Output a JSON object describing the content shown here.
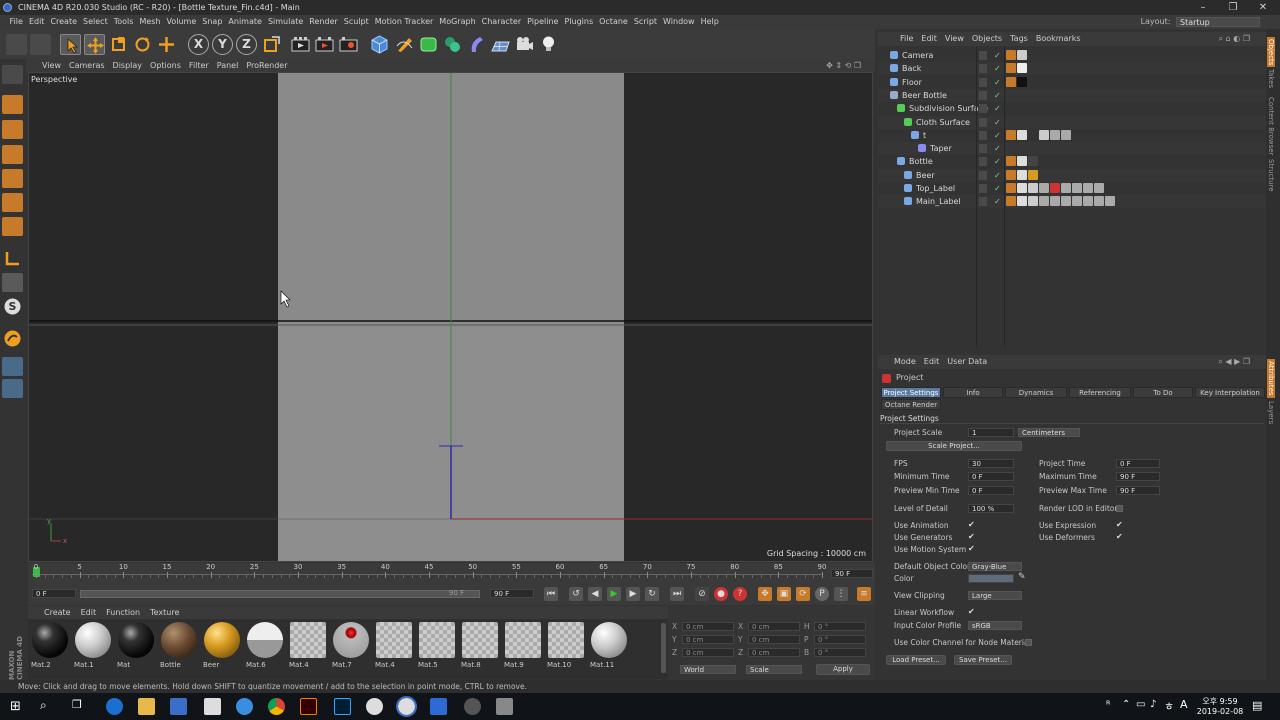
{
  "window": {
    "title": "CINEMA 4D R20.030 Studio (RC - R20) - [Bottle Texture_Fin.c4d] - Main"
  },
  "menu": [
    "File",
    "Edit",
    "Create",
    "Select",
    "Tools",
    "Mesh",
    "Volume",
    "Snap",
    "Animate",
    "Simulate",
    "Render",
    "Sculpt",
    "Motion Tracker",
    "MoGraph",
    "Character",
    "Pipeline",
    "Plugins",
    "Octane",
    "Script",
    "Window",
    "Help"
  ],
  "layout": {
    "label": "Layout:",
    "value": "Startup"
  },
  "toolbar": {
    "x": "X",
    "y": "Y",
    "z": "Z"
  },
  "viewport": {
    "menu": [
      "View",
      "Cameras",
      "Display",
      "Options",
      "Filter",
      "Panel",
      "ProRender"
    ],
    "label": "Perspective",
    "grid_spacing": "Grid Spacing : 10000 cm",
    "axis_x": "x",
    "axis_y": "y"
  },
  "timeline": {
    "ticks": [
      "0",
      "5",
      "10",
      "15",
      "20",
      "25",
      "30",
      "35",
      "40",
      "45",
      "50",
      "55",
      "60",
      "65",
      "70",
      "75",
      "80",
      "85",
      "90"
    ],
    "current_frame": "0 F",
    "start": "0 F",
    "end": "90 F",
    "end_field": "90 F",
    "right_field": "90 F"
  },
  "materials": {
    "menu": [
      "Create",
      "Edit",
      "Function",
      "Texture"
    ],
    "items": [
      {
        "name": "Mat.2",
        "kind": "black"
      },
      {
        "name": "Mat.1",
        "kind": "white"
      },
      {
        "name": "Mat",
        "kind": "black"
      },
      {
        "name": "Bottle",
        "kind": "brown"
      },
      {
        "name": "Beer",
        "kind": "gold"
      },
      {
        "name": "Mat.6",
        "kind": "half"
      },
      {
        "name": "Mat.4",
        "kind": "check"
      },
      {
        "name": "Mat.7",
        "kind": "red"
      },
      {
        "name": "Mat.4",
        "kind": "check"
      },
      {
        "name": "Mat.5",
        "kind": "check"
      },
      {
        "name": "Mat.8",
        "kind": "check"
      },
      {
        "name": "Mat.9",
        "kind": "check"
      },
      {
        "name": "Mat.10",
        "kind": "check"
      },
      {
        "name": "Mat.11",
        "kind": "white"
      }
    ],
    "brand": "MAXON CINEMA 4D"
  },
  "coords": {
    "rows": [
      {
        "a": "X",
        "av": "0 cm",
        "b": "X",
        "bv": "0 cm",
        "c": "H",
        "cv": "0 °"
      },
      {
        "a": "Y",
        "av": "0 cm",
        "b": "Y",
        "bv": "0 cm",
        "c": "P",
        "cv": "0 °"
      },
      {
        "a": "Z",
        "av": "0 cm",
        "b": "Z",
        "bv": "0 cm",
        "c": "B",
        "cv": "0 °"
      }
    ],
    "world": "World",
    "scale": "Scale",
    "apply": "Apply"
  },
  "status": "Move: Click and drag to move elements. Hold down SHIFT to quantize movement / add to the selection in point mode, CTRL to remove.",
  "objects": {
    "menu": [
      "File",
      "Edit",
      "View",
      "Objects",
      "Tags",
      "Bookmarks"
    ],
    "rows": [
      {
        "name": "Camera",
        "indent": 0,
        "icon": "#7aa7e6"
      },
      {
        "name": "Back",
        "indent": 0,
        "icon": "#7aa7e6"
      },
      {
        "name": "Floor",
        "indent": 0,
        "icon": "#7aa7e6"
      },
      {
        "name": "Beer Bottle",
        "indent": 0,
        "icon": "#9ac"
      },
      {
        "name": "Subdivision Surface",
        "indent": 1,
        "icon": "#5c5"
      },
      {
        "name": "Cloth Surface",
        "indent": 2,
        "icon": "#5c5"
      },
      {
        "name": "t",
        "indent": 3,
        "icon": "#7aa7e6"
      },
      {
        "name": "Taper",
        "indent": 4,
        "icon": "#8a8af0"
      },
      {
        "name": "Bottle",
        "indent": 1,
        "icon": "#7aa7e6"
      },
      {
        "name": "Beer",
        "indent": 2,
        "icon": "#7aa7e6"
      },
      {
        "name": "Top_Label",
        "indent": 2,
        "icon": "#7aa7e6"
      },
      {
        "name": "Main_Label",
        "indent": 2,
        "icon": "#7aa7e6"
      }
    ]
  },
  "attributes": {
    "menu": [
      "Mode",
      "Edit",
      "User Data"
    ],
    "header": "Project",
    "tabs": [
      "Project Settings",
      "Info",
      "Dynamics",
      "Referencing",
      "To Do",
      "Key Interpolation"
    ],
    "tab2": "Octane Render",
    "section": "Project Settings",
    "project_scale_label": "Project Scale",
    "project_scale": "1",
    "unit": "Centimeters",
    "scale_project": "Scale Project...",
    "fps_label": "FPS",
    "fps": "30",
    "project_time_label": "Project Time",
    "project_time": "0 F",
    "min_time_label": "Minimum Time",
    "min_time": "0 F",
    "max_time_label": "Maximum Time",
    "max_time": "90 F",
    "prev_min_label": "Preview Min Time",
    "prev_min": "0 F",
    "prev_max_label": "Preview Max Time",
    "prev_max": "90 F",
    "lod_label": "Level of Detail",
    "lod": "100 %",
    "render_lod_label": "Render LOD in Editor",
    "use_anim_label": "Use Animation",
    "use_expr_label": "Use Expression",
    "use_gen_label": "Use Generators",
    "use_def_label": "Use Deformers",
    "use_motion_label": "Use Motion System",
    "default_color_label": "Default Object Color",
    "default_color": "Gray-Blue",
    "color_label": "Color",
    "view_clip_label": "View Clipping",
    "view_clip": "Large",
    "linear_label": "Linear Workflow",
    "input_profile_label": "Input Color Profile",
    "input_profile": "sRGB",
    "use_color_label": "Use Color Channel for Node Material",
    "load_preset": "Load Preset...",
    "save_preset": "Save Preset..."
  },
  "sidetabs": [
    "Objects",
    "Takes",
    "Content Browser",
    "Structure"
  ],
  "sidetabs2": [
    "Attributes",
    "Layers"
  ],
  "taskbar": {
    "time": "오후 9:59",
    "date": "2019-02-08",
    "lang": "A",
    "lang2": "ㅎ"
  }
}
